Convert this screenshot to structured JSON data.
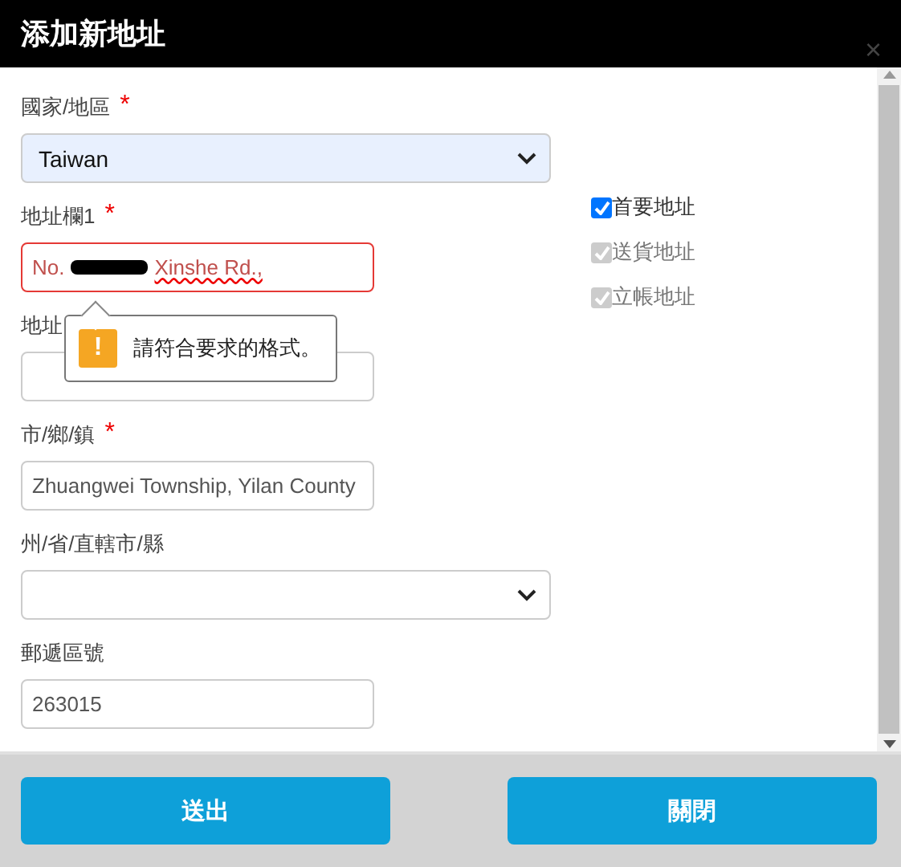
{
  "dialog": {
    "title": "添加新地址",
    "close": "×"
  },
  "fields": [
    {
      "kind": "select",
      "label": "國家/地區",
      "required_mark": "*",
      "value": "Taiwan",
      "autofilled": true
    },
    {
      "kind": "text",
      "label": "地址欄1",
      "required_mark": "*",
      "invalid": true,
      "value_parts": [
        {
          "kind": "text",
          "text": "No."
        },
        {
          "kind": "redaction"
        },
        {
          "kind": "text",
          "text": "Xinshe Rd.,"
        }
      ]
    },
    {
      "kind": "text",
      "label": "地址",
      "invalid": false
    },
    {
      "kind": "text",
      "label": "市/鄉/鎮",
      "required_mark": "*",
      "invalid": false,
      "value_parts": [
        {
          "kind": "text",
          "text": "Zhuangwei Township, Yilan County"
        }
      ]
    },
    {
      "kind": "select",
      "label": "州/省/直轄市/縣",
      "autofilled": false
    },
    {
      "kind": "text",
      "label": "郵遞區號",
      "invalid": false,
      "value_parts": [
        {
          "kind": "text",
          "text": "263015"
        }
      ]
    }
  ],
  "tooltip": {
    "message": "請符合要求的格式。",
    "icon": "!"
  },
  "checkboxes": [
    {
      "label": "首要地址",
      "checked": true,
      "disabled": false
    },
    {
      "label": "送貨地址",
      "checked": true,
      "disabled": true
    },
    {
      "label": "立帳地址",
      "checked": true,
      "disabled": true
    }
  ],
  "buttons": [
    "送出",
    "關閉"
  ]
}
